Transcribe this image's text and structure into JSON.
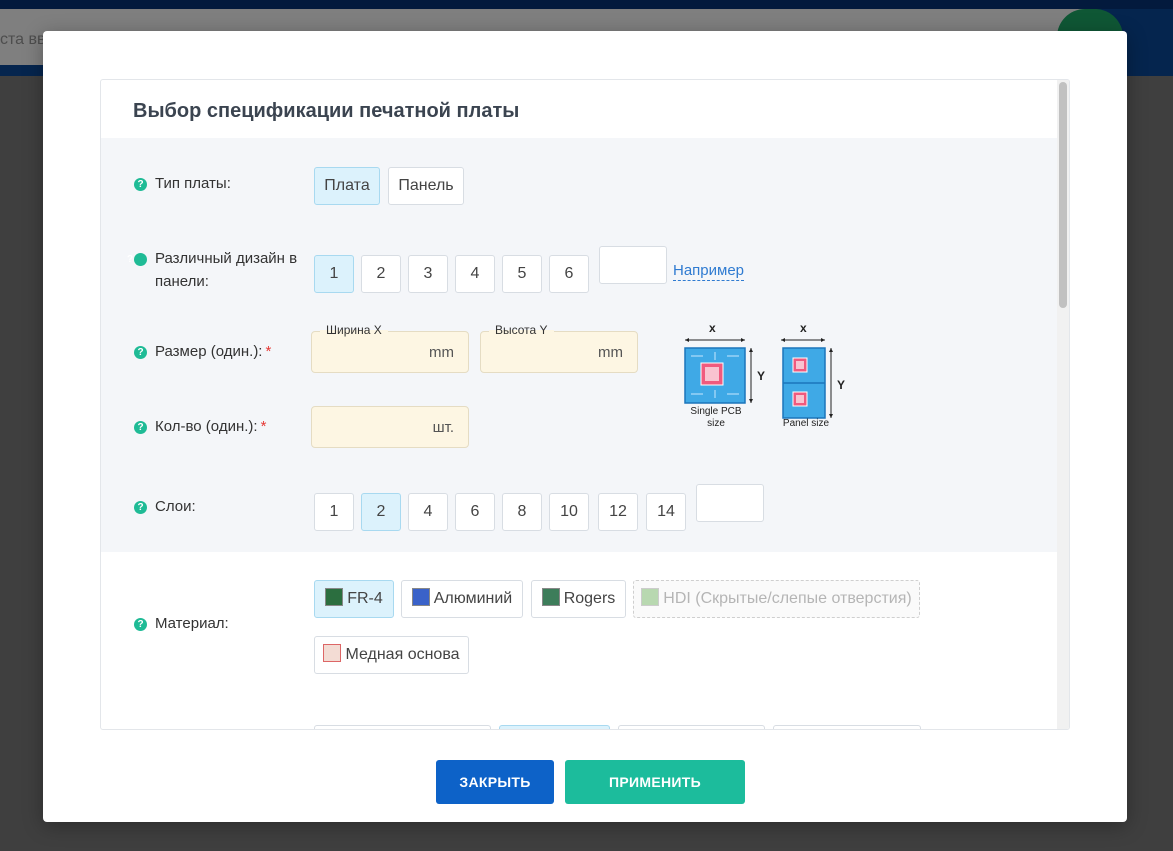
{
  "background": {
    "search_placeholder": "ста введите партномер (артикул)"
  },
  "panel": {
    "title": "Выбор спецификации печатной платы"
  },
  "board_type": {
    "label": "Тип платы:",
    "options": [
      "Плата",
      "Панель"
    ],
    "selected": "Плата"
  },
  "designs": {
    "label": "Различный дизайн в панели:",
    "options": [
      "1",
      "2",
      "3",
      "4",
      "5",
      "6"
    ],
    "selected": "1",
    "example_link": "Например"
  },
  "size": {
    "label": "Размер (один.):",
    "required_mark": "*",
    "width_caption": "Ширина X",
    "height_caption": "Высота Y",
    "unit": "mm"
  },
  "quantity": {
    "label": "Кол-во (один.):",
    "required_mark": "*",
    "unit": "шт."
  },
  "diagram": {
    "axis_x": "x",
    "axis_y": "Y",
    "single_label_1": "Single PCB",
    "single_label_2": "size",
    "panel_label": "Panel size"
  },
  "layers": {
    "label": "Слои:",
    "options": [
      "1",
      "2",
      "4",
      "6",
      "8",
      "10",
      "12",
      "14"
    ],
    "selected": "2"
  },
  "material": {
    "label": "Материал:",
    "options": [
      "FR-4",
      "Алюминий",
      "Rogers",
      "HDI (Скрытые/слепые отверстия)",
      "Медная основа"
    ],
    "selected": "FR-4",
    "disabled": "HDI (Скрытые/слепые отверстия)"
  },
  "footer": {
    "close_label": "ЗАКРЫТЬ",
    "apply_label": "ПРИМЕНИТЬ"
  },
  "colors": {
    "accent_blue": "#0d62c8",
    "accent_green": "#1cbc9c",
    "selected_bg": "#dcf2fc",
    "input_bg": "#fdf6e3"
  }
}
